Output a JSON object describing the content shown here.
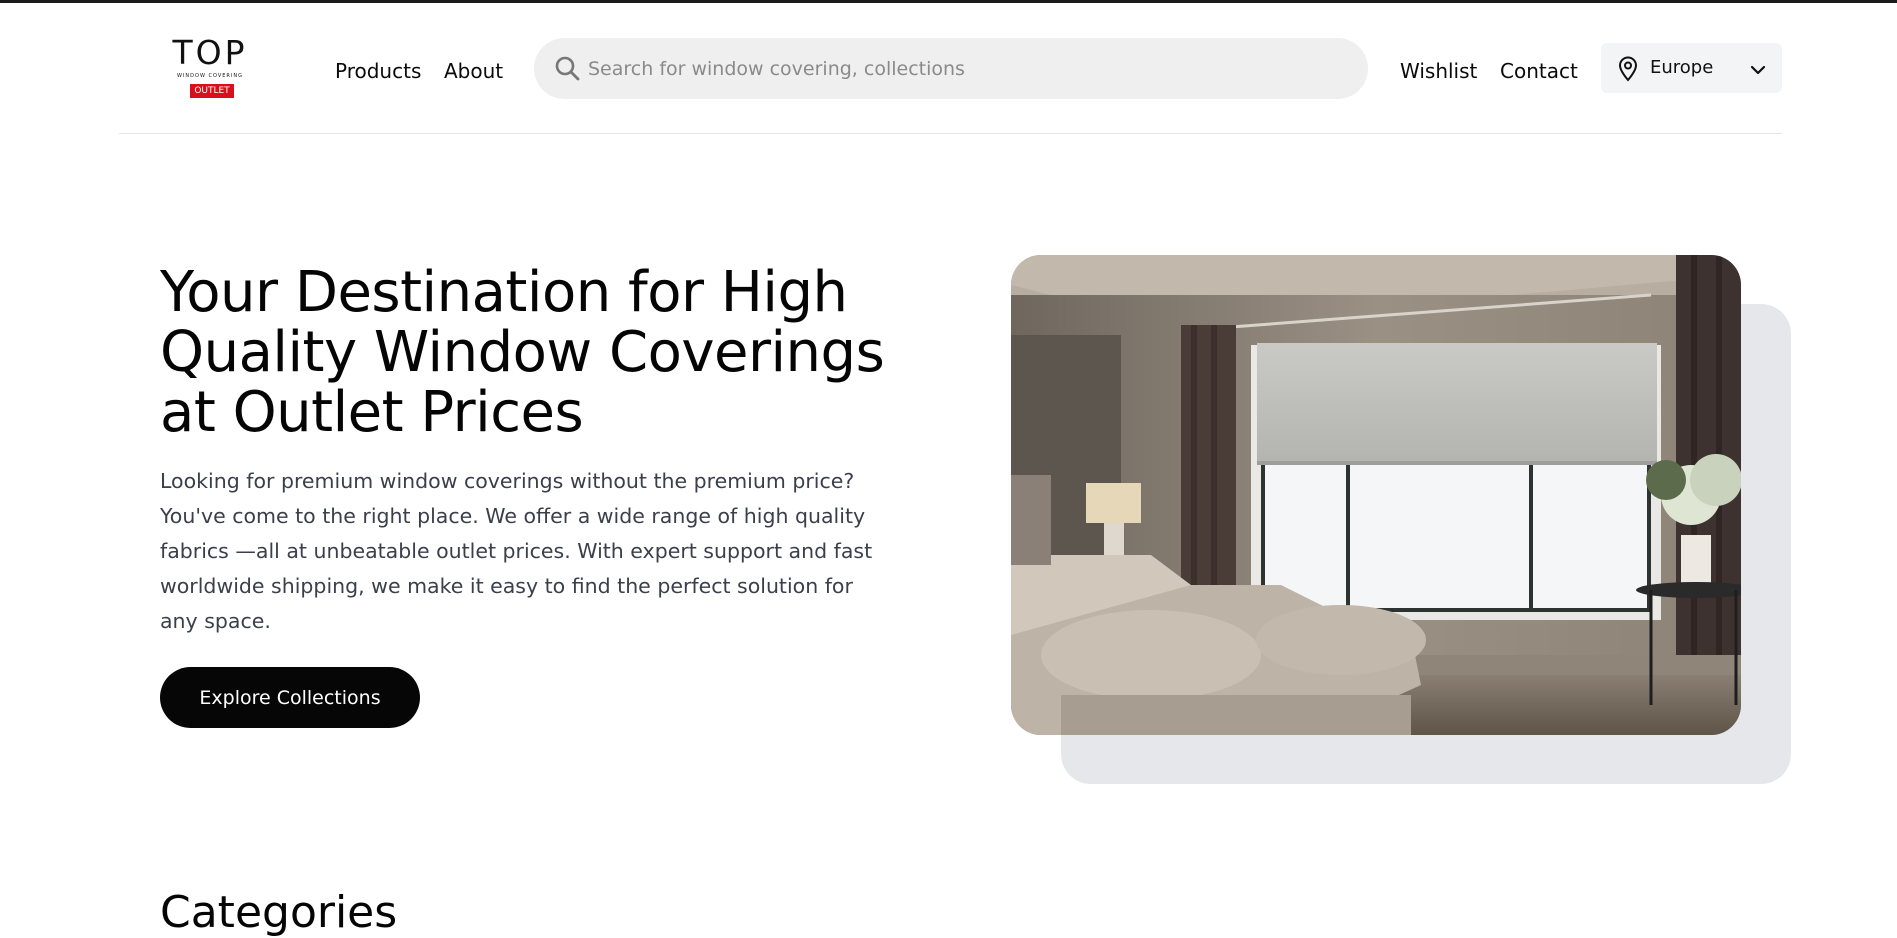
{
  "logo": {
    "top": "TOP",
    "subtitle": "WINDOW COVERING",
    "badge": "OUTLET",
    "badge_color": "#d7101b"
  },
  "nav": {
    "products": "Products",
    "about": "About",
    "wishlist": "Wishlist",
    "contact": "Contact"
  },
  "search": {
    "placeholder": "Search for window covering, collections",
    "value": ""
  },
  "region": {
    "selected": "Europe"
  },
  "hero": {
    "title": "Your Destination for High Quality Window Coverings at Outlet Prices",
    "description": "Looking for premium window coverings without the premium price? You've come to the right place. We offer a wide range of high quality fabrics —all at unbeatable outlet prices. With expert support and fast worldwide shipping, we make it easy to find the perfect solution for any space.",
    "cta": "Explore Collections",
    "image_subject": "bedroom with roller blind"
  },
  "next_section": {
    "heading": "Categories"
  },
  "colors": {
    "accent": "#060606",
    "panel": "#e6e7ea",
    "search_bg": "#efefef"
  }
}
